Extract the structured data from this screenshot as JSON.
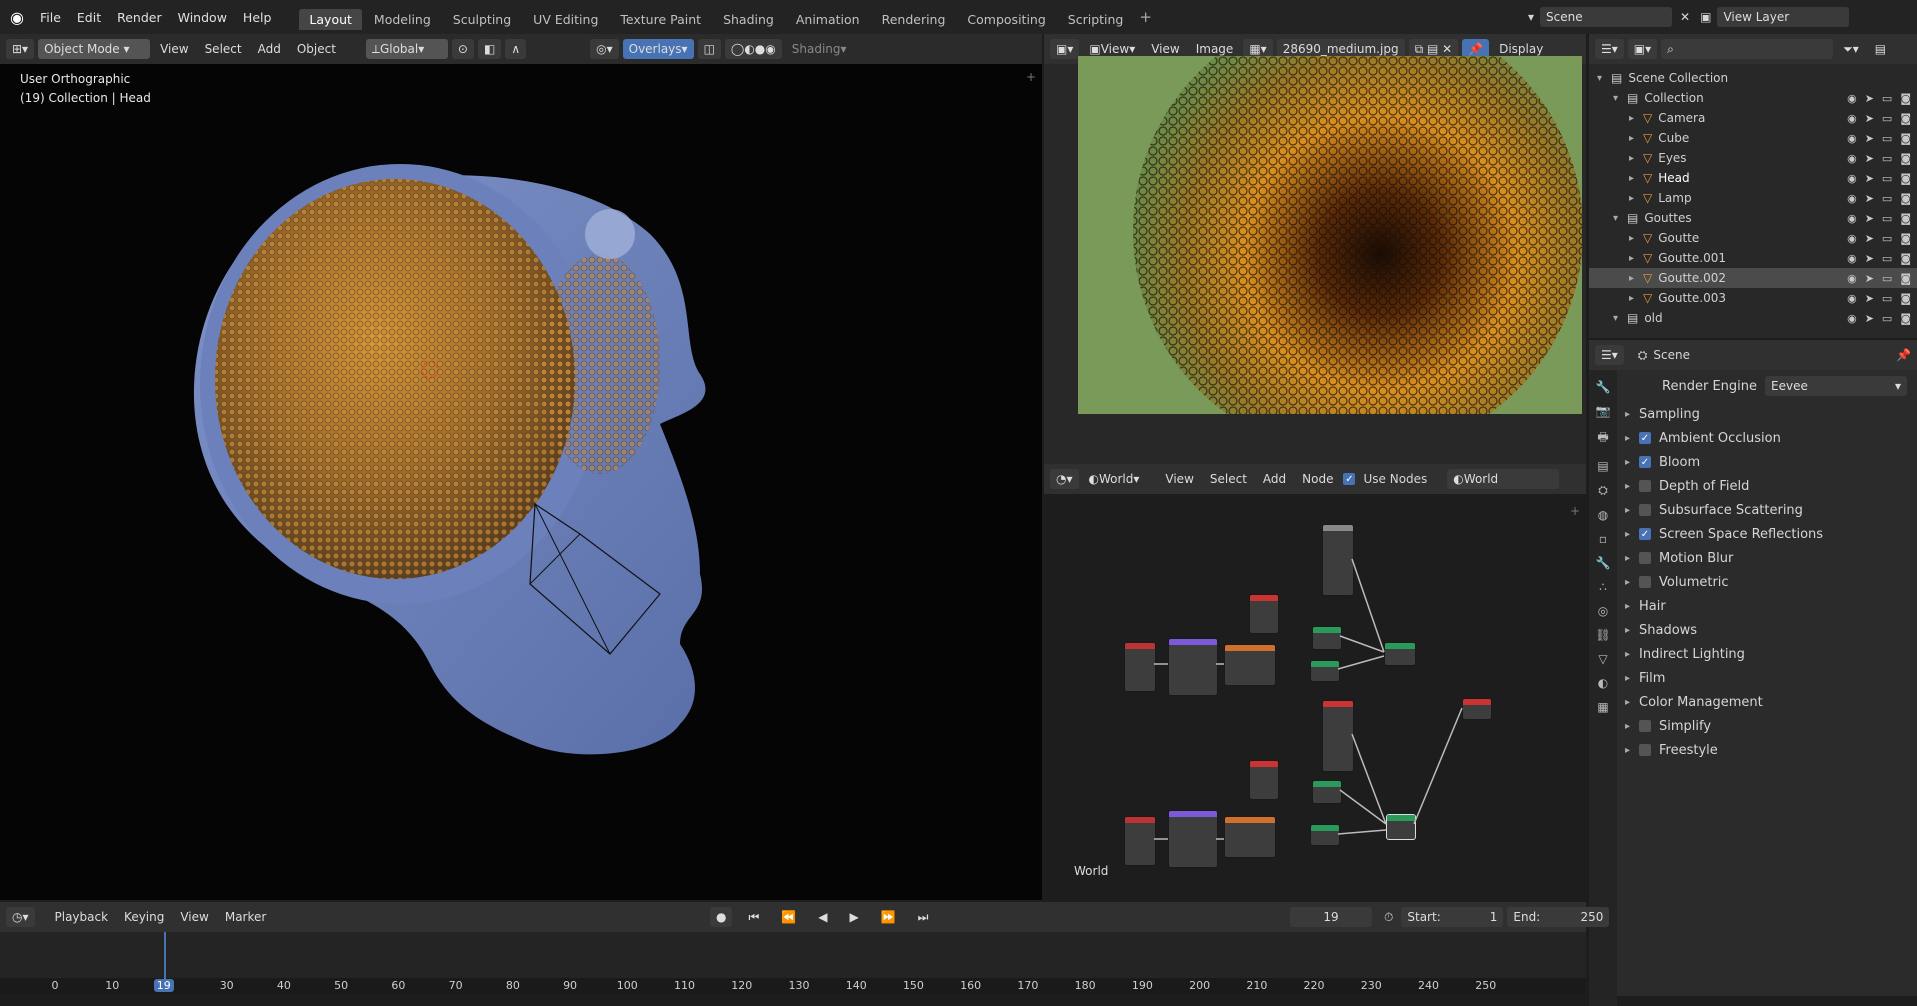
{
  "app": {
    "logo_icon": "blender-logo-icon"
  },
  "menu": [
    "File",
    "Edit",
    "Render",
    "Window",
    "Help"
  ],
  "workspaces": [
    "Layout",
    "Modeling",
    "Sculpting",
    "UV Editing",
    "Texture Paint",
    "Shading",
    "Animation",
    "Rendering",
    "Compositing",
    "Scripting"
  ],
  "active_workspace": "Layout",
  "scene": {
    "label": "Scene",
    "view_layer": "View Layer"
  },
  "viewport": {
    "mode": "Object Mode",
    "menus": [
      "View",
      "Select",
      "Add",
      "Object"
    ],
    "transform": "Global",
    "overlays": "Overlays",
    "shading": "Shading",
    "info_line1": "User Orthographic",
    "info_line2": "(19) Collection | Head"
  },
  "image_editor": {
    "view": "View",
    "view2": "View",
    "image_menu": "Image",
    "filename": "28690_medium.jpg",
    "display": "Display"
  },
  "outliner": {
    "search_placeholder": "",
    "rows": [
      {
        "label": "Scene Collection",
        "indent": 0,
        "type": "scene"
      },
      {
        "label": "Collection",
        "indent": 1,
        "type": "collection"
      },
      {
        "label": "Camera",
        "indent": 2,
        "type": "object"
      },
      {
        "label": "Cube",
        "indent": 2,
        "type": "object"
      },
      {
        "label": "Eyes",
        "indent": 2,
        "type": "object"
      },
      {
        "label": "Head",
        "indent": 2,
        "type": "object",
        "active": true
      },
      {
        "label": "Lamp",
        "indent": 2,
        "type": "object"
      },
      {
        "label": "Gouttes",
        "indent": 1,
        "type": "collection"
      },
      {
        "label": "Goutte",
        "indent": 2,
        "type": "object"
      },
      {
        "label": "Goutte.001",
        "indent": 2,
        "type": "object"
      },
      {
        "label": "Goutte.002",
        "indent": 2,
        "type": "object",
        "selected": true
      },
      {
        "label": "Goutte.003",
        "indent": 2,
        "type": "object"
      },
      {
        "label": "old",
        "indent": 1,
        "type": "collection"
      }
    ]
  },
  "node_editor": {
    "world": "World",
    "menus": [
      "View",
      "Select",
      "Add",
      "Node"
    ],
    "use_nodes": "Use Nodes",
    "world_slot": "World",
    "label": "World"
  },
  "properties": {
    "context": "Scene",
    "render_engine_label": "Render Engine",
    "render_engine": "Eevee",
    "panels": [
      {
        "label": "Sampling",
        "check": null
      },
      {
        "label": "Ambient Occlusion",
        "check": true
      },
      {
        "label": "Bloom",
        "check": true
      },
      {
        "label": "Depth of Field",
        "check": false
      },
      {
        "label": "Subsurface Scattering",
        "check": false
      },
      {
        "label": "Screen Space Reflections",
        "check": true
      },
      {
        "label": "Motion Blur",
        "check": false
      },
      {
        "label": "Volumetric",
        "check": false
      },
      {
        "label": "Hair",
        "check": null
      },
      {
        "label": "Shadows",
        "check": null
      },
      {
        "label": "Indirect Lighting",
        "check": null
      },
      {
        "label": "Film",
        "check": null
      },
      {
        "label": "Color Management",
        "check": null
      },
      {
        "label": "Simplify",
        "check": false
      },
      {
        "label": "Freestyle",
        "check": false
      }
    ]
  },
  "timeline": {
    "menus": [
      "Playback",
      "Keying",
      "View",
      "Marker"
    ],
    "current_frame": "19",
    "start_label": "Start:",
    "start": "1",
    "end_label": "End:",
    "end": "250",
    "ticks": [
      "0",
      "10",
      "19",
      "30",
      "40",
      "50",
      "60",
      "70",
      "80",
      "90",
      "100",
      "110",
      "120",
      "130",
      "140",
      "150",
      "160",
      "170",
      "180",
      "190",
      "200",
      "210",
      "220",
      "230",
      "240",
      "250"
    ]
  }
}
